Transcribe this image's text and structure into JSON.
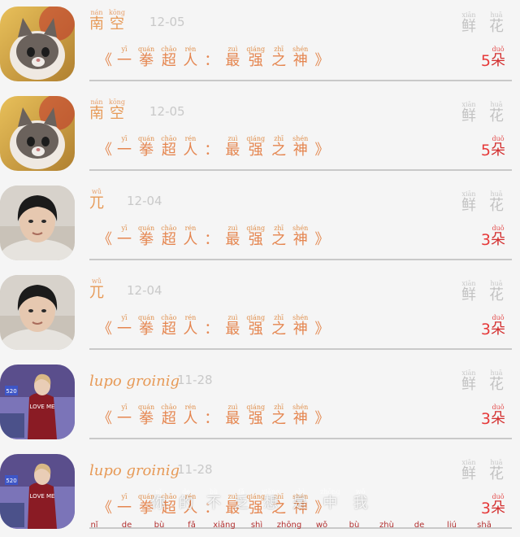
{
  "rows": [
    {
      "name_type": "ruby",
      "name_chars": [
        {
          "py": "nán",
          "ch": "南"
        },
        {
          "py": "kōng",
          "ch": "空"
        }
      ],
      "date": "12-05",
      "gift_label": [
        {
          "py": "xiān",
          "ch": "鲜"
        },
        {
          "py": "huā",
          "ch": "花"
        }
      ],
      "book_open": "《",
      "book_chars": [
        {
          "py": "yī",
          "ch": "一"
        },
        {
          "py": "quán",
          "ch": "拳"
        },
        {
          "py": "chāo",
          "ch": "超"
        },
        {
          "py": "rén",
          "ch": "人"
        },
        {
          "py": "",
          "ch": "："
        },
        {
          "py": "zuì",
          "ch": "最"
        },
        {
          "py": "qiáng",
          "ch": "强"
        },
        {
          "py": "zhī",
          "ch": "之"
        },
        {
          "py": "shén",
          "ch": "神"
        }
      ],
      "book_close": "》",
      "count": "5",
      "count_unit": {
        "py": "duǒ",
        "ch": "朵"
      },
      "avatar": "cat-avatar"
    },
    {
      "name_type": "ruby",
      "name_chars": [
        {
          "py": "nán",
          "ch": "南"
        },
        {
          "py": "kōng",
          "ch": "空"
        }
      ],
      "date": "12-05",
      "gift_label": [
        {
          "py": "xiān",
          "ch": "鲜"
        },
        {
          "py": "huā",
          "ch": "花"
        }
      ],
      "book_open": "《",
      "book_chars": [
        {
          "py": "yī",
          "ch": "一"
        },
        {
          "py": "quán",
          "ch": "拳"
        },
        {
          "py": "chāo",
          "ch": "超"
        },
        {
          "py": "rén",
          "ch": "人"
        },
        {
          "py": "",
          "ch": "："
        },
        {
          "py": "zuì",
          "ch": "最"
        },
        {
          "py": "qiáng",
          "ch": "强"
        },
        {
          "py": "zhī",
          "ch": "之"
        },
        {
          "py": "shén",
          "ch": "神"
        }
      ],
      "book_close": "》",
      "count": "5",
      "count_unit": {
        "py": "duǒ",
        "ch": "朵"
      },
      "avatar": "cat-avatar"
    },
    {
      "name_type": "ruby",
      "name_chars": [
        {
          "py": "wǔ",
          "ch": "兀"
        }
      ],
      "date": "12-04",
      "gift_label": [
        {
          "py": "xiān",
          "ch": "鲜"
        },
        {
          "py": "huā",
          "ch": "花"
        }
      ],
      "book_open": "《",
      "book_chars": [
        {
          "py": "yī",
          "ch": "一"
        },
        {
          "py": "quán",
          "ch": "拳"
        },
        {
          "py": "chāo",
          "ch": "超"
        },
        {
          "py": "rén",
          "ch": "人"
        },
        {
          "py": "",
          "ch": "："
        },
        {
          "py": "zuì",
          "ch": "最"
        },
        {
          "py": "qiáng",
          "ch": "强"
        },
        {
          "py": "zhī",
          "ch": "之"
        },
        {
          "py": "shén",
          "ch": "神"
        }
      ],
      "book_close": "》",
      "count": "3",
      "count_unit": {
        "py": "duǒ",
        "ch": "朵"
      },
      "avatar": "person-avatar"
    },
    {
      "name_type": "ruby",
      "name_chars": [
        {
          "py": "wǔ",
          "ch": "兀"
        }
      ],
      "date": "12-04",
      "gift_label": [
        {
          "py": "xiān",
          "ch": "鲜"
        },
        {
          "py": "huā",
          "ch": "花"
        }
      ],
      "book_open": "《",
      "book_chars": [
        {
          "py": "yī",
          "ch": "一"
        },
        {
          "py": "quán",
          "ch": "拳"
        },
        {
          "py": "chāo",
          "ch": "超"
        },
        {
          "py": "rén",
          "ch": "人"
        },
        {
          "py": "",
          "ch": "："
        },
        {
          "py": "zuì",
          "ch": "最"
        },
        {
          "py": "qiáng",
          "ch": "强"
        },
        {
          "py": "zhī",
          "ch": "之"
        },
        {
          "py": "shén",
          "ch": "神"
        }
      ],
      "book_close": "》",
      "count": "3",
      "count_unit": {
        "py": "duǒ",
        "ch": "朵"
      },
      "avatar": "person-avatar"
    },
    {
      "name_type": "plain",
      "name_text": "lupo groinig",
      "date": "11-28",
      "gift_label": [
        {
          "py": "xiān",
          "ch": "鲜"
        },
        {
          "py": "huā",
          "ch": "花"
        }
      ],
      "book_open": "《",
      "book_chars": [
        {
          "py": "yī",
          "ch": "一"
        },
        {
          "py": "quán",
          "ch": "拳"
        },
        {
          "py": "chāo",
          "ch": "超"
        },
        {
          "py": "rén",
          "ch": "人"
        },
        {
          "py": "",
          "ch": "："
        },
        {
          "py": "zuì",
          "ch": "最"
        },
        {
          "py": "qiáng",
          "ch": "强"
        },
        {
          "py": "zhī",
          "ch": "之"
        },
        {
          "py": "shén",
          "ch": "神"
        }
      ],
      "book_close": "》",
      "count": "3",
      "count_unit": {
        "py": "duǒ",
        "ch": "朵"
      },
      "avatar": "loveme-avatar"
    },
    {
      "name_type": "plain",
      "name_text": "lupo groinig",
      "date": "11-28",
      "gift_label": [
        {
          "py": "xiān",
          "ch": "鲜"
        },
        {
          "py": "huā",
          "ch": "花"
        }
      ],
      "book_open": "《",
      "book_chars": [
        {
          "py": "yī",
          "ch": "一"
        },
        {
          "py": "quán",
          "ch": "拳"
        },
        {
          "py": "chāo",
          "ch": "超"
        },
        {
          "py": "rén",
          "ch": "人"
        },
        {
          "py": "",
          "ch": "："
        },
        {
          "py": "zuì",
          "ch": "最"
        },
        {
          "py": "qiáng",
          "ch": "强"
        },
        {
          "py": "zhī",
          "ch": "之"
        },
        {
          "py": "shén",
          "ch": "神"
        }
      ],
      "book_close": "》",
      "count": "3",
      "count_unit": {
        "py": "duǒ",
        "ch": "朵"
      },
      "avatar": "loveme-avatar"
    }
  ],
  "avatar_text": {
    "badge": "520",
    "shirt": "LOVE ME"
  },
  "overlay": {
    "ghost_chars": [
      {
        "py": "nǐ",
        "ch": "你"
      },
      {
        "py": "de",
        "ch": "的"
      },
      {
        "py": "bù",
        "ch": "不"
      },
      {
        "py": "fǎ",
        "ch": "乏"
      },
      {
        "py": "xiǎng",
        "ch": "想"
      },
      {
        "py": "shì",
        "ch": "是"
      },
      {
        "py": "zhōng",
        "ch": "中"
      },
      {
        "py": "wǒ",
        "ch": "我"
      }
    ],
    "pinyin_line": [
      "nǐ",
      "de",
      "bù",
      "fǎ",
      "xiǎng",
      "shì",
      "zhōng",
      "wǒ",
      "bù",
      "zhù",
      "de",
      "liú",
      "shā"
    ]
  }
}
